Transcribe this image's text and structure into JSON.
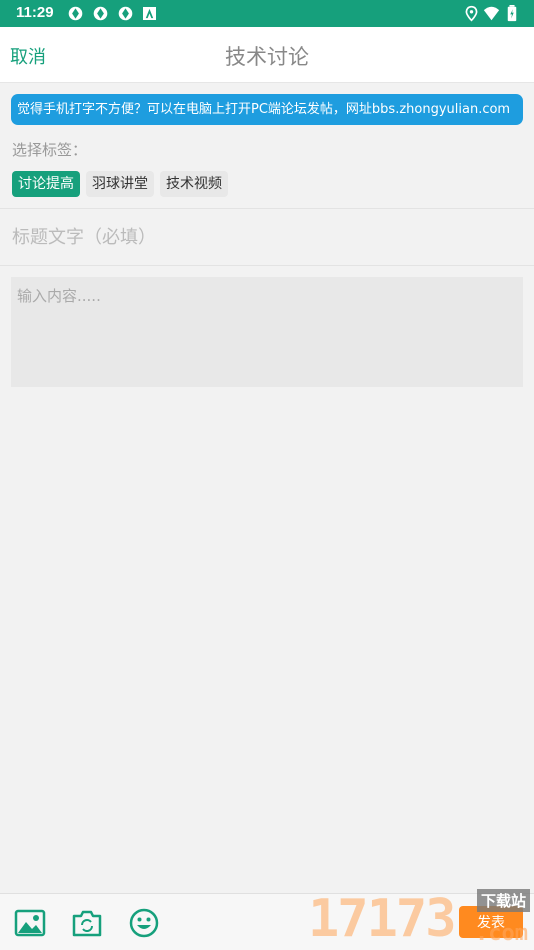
{
  "status_bar": {
    "time": "11:29"
  },
  "header": {
    "cancel_label": "取消",
    "title": "技术讨论"
  },
  "notice": "觉得手机打字不方便？可以在电脑上打开PC端论坛发帖，网址bbs.zhongyulian.com",
  "tags": {
    "label": "选择标签：",
    "items": [
      {
        "label": "讨论提高",
        "selected": true
      },
      {
        "label": "羽球讲堂",
        "selected": false
      },
      {
        "label": "技术视频",
        "selected": false
      }
    ]
  },
  "title_field": {
    "placeholder": "标题文字（必填）",
    "value": ""
  },
  "content_field": {
    "placeholder": "输入内容.....",
    "value": ""
  },
  "toolbar": {
    "icons": [
      "image-icon",
      "camera-icon",
      "emoji-icon"
    ]
  },
  "publish_label": "发表",
  "watermark": {
    "number": "17173",
    "site": "下载站",
    "suffix": ".com"
  },
  "colors": {
    "accent": "#16a07c",
    "notice": "#1e9ddf",
    "publish": "#ff8a1f"
  }
}
